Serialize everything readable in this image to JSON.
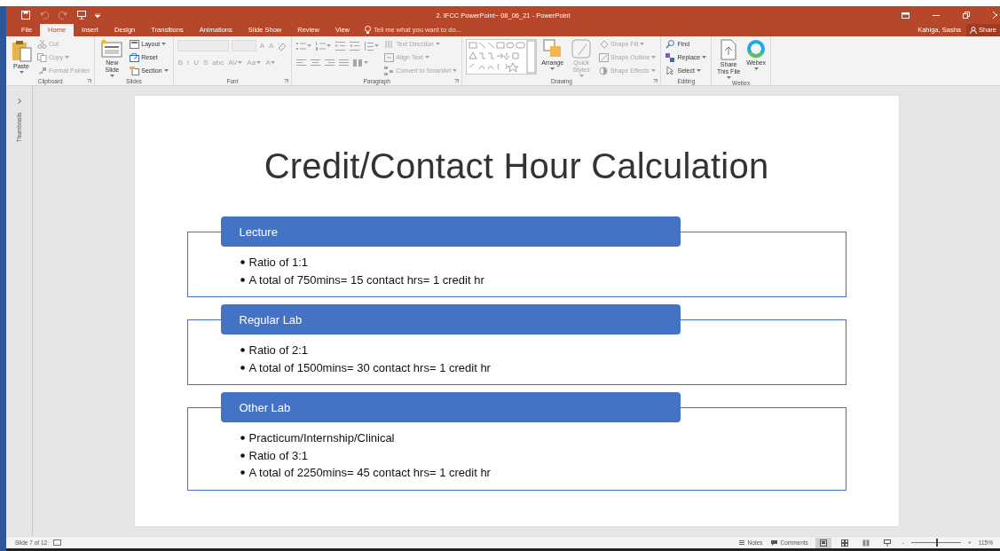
{
  "window": {
    "title": "2. IFCC PowerPoint~ 08_06_21 - PowerPoint",
    "user": "Kahiga, Sasha",
    "share": "Share"
  },
  "quick_access": [
    {
      "disabled": false
    },
    {
      "disabled": true
    },
    {
      "disabled": true
    },
    {
      "disabled": false
    }
  ],
  "tabs": [
    {
      "label": "File",
      "selected": false
    },
    {
      "label": "Home",
      "selected": true
    },
    {
      "label": "Insert",
      "selected": false
    },
    {
      "label": "Design",
      "selected": false
    },
    {
      "label": "Transitions",
      "selected": false
    },
    {
      "label": "Animations",
      "selected": false
    },
    {
      "label": "Slide Show",
      "selected": false
    },
    {
      "label": "Review",
      "selected": false
    },
    {
      "label": "View",
      "selected": false
    }
  ],
  "tell_me": {
    "placeholder": "Tell me what you want to do..."
  },
  "ribbon": [
    {
      "name": "Clipboard",
      "launcher": true,
      "columns": [
        [
          {
            "kind": "large",
            "label": "Paste",
            "dropdown": true,
            "disabled": false
          }
        ],
        [
          {
            "kind": "small",
            "label": "Cut",
            "dropdown": false,
            "disabled": true
          },
          {
            "kind": "small",
            "label": "Copy",
            "dropdown": true,
            "disabled": true
          },
          {
            "kind": "small",
            "label": "Format Painter",
            "dropdown": false,
            "disabled": true
          }
        ]
      ]
    },
    {
      "name": "Slides",
      "launcher": false,
      "columns": [
        [
          {
            "kind": "large",
            "label": "New Slide",
            "dropdown": true,
            "disabled": false
          }
        ],
        [
          {
            "kind": "small",
            "label": "Layout",
            "dropdown": true,
            "disabled": false
          },
          {
            "kind": "small",
            "label": "Reset",
            "dropdown": false,
            "disabled": false
          },
          {
            "kind": "small",
            "label": "Section",
            "dropdown": true,
            "disabled": false
          }
        ]
      ]
    },
    {
      "name": "Font",
      "launcher": true,
      "columns": [
        [
          {
            "kind": "row",
            "items": [
              {
                "kind": "field",
                "disabled": true
              },
              {
                "kind": "field",
                "disabled": true
              },
              {
                "kind": "glyph",
                "label": "A",
                "dropdown": false,
                "disabled": true
              },
              {
                "kind": "glyph",
                "label": "A",
                "dropdown": false,
                "disabled": true
              },
              {
                "kind": "icon",
                "dropdown": false,
                "disabled": true
              }
            ]
          },
          {
            "kind": "row",
            "items": [
              {
                "kind": "glyph",
                "label": "B",
                "dropdown": false,
                "disabled": true
              },
              {
                "kind": "glyph",
                "label": "I",
                "dropdown": false,
                "disabled": true
              },
              {
                "kind": "glyph",
                "label": "U",
                "dropdown": false,
                "disabled": true
              },
              {
                "kind": "glyph",
                "label": "S",
                "dropdown": false,
                "disabled": true
              },
              {
                "kind": "glyph",
                "label": "abc",
                "dropdown": false,
                "disabled": true
              },
              {
                "kind": "glyph",
                "label": "AV",
                "dropdown": true,
                "disabled": true
              },
              {
                "kind": "glyph",
                "label": "Aa",
                "dropdown": true,
                "disabled": true
              },
              {
                "kind": "glyph",
                "label": "A",
                "dropdown": true,
                "disabled": true
              }
            ]
          }
        ]
      ]
    },
    {
      "name": "Paragraph",
      "launcher": true,
      "columns": [
        [
          {
            "kind": "row",
            "items": [
              {
                "kind": "icon",
                "dropdown": true,
                "disabled": true
              },
              {
                "kind": "icon",
                "dropdown": true,
                "disabled": true
              },
              {
                "kind": "icon",
                "dropdown": false,
                "disabled": true
              },
              {
                "kind": "icon",
                "dropdown": false,
                "disabled": true
              },
              {
                "kind": "icon",
                "dropdown": true,
                "disabled": true
              }
            ]
          },
          {
            "kind": "row",
            "items": [
              {
                "kind": "icon",
                "dropdown": false,
                "disabled": true
              },
              {
                "kind": "icon",
                "dropdown": false,
                "disabled": true
              },
              {
                "kind": "icon",
                "dropdown": false,
                "disabled": true
              },
              {
                "kind": "icon",
                "dropdown": false,
                "disabled": true
              },
              {
                "kind": "icon",
                "dropdown": true,
                "disabled": true
              }
            ]
          }
        ],
        [
          {
            "kind": "small",
            "label": "Text Direction",
            "dropdown": true,
            "disabled": true
          },
          {
            "kind": "small",
            "label": "Align Text",
            "dropdown": true,
            "disabled": true
          },
          {
            "kind": "small",
            "label": "Convert to SmartArt",
            "dropdown": true,
            "disabled": true
          }
        ]
      ]
    },
    {
      "name": "Drawing",
      "launcher": true,
      "columns": [
        [
          {
            "kind": "gallery",
            "disabled": true
          }
        ],
        [
          {
            "kind": "large",
            "label": "Arrange",
            "dropdown": true,
            "disabled": false
          }
        ],
        [
          {
            "kind": "large",
            "label": "Quick Styles",
            "dropdown": true,
            "disabled": true
          }
        ],
        [
          {
            "kind": "small",
            "label": "Shape Fill",
            "dropdown": true,
            "disabled": true
          },
          {
            "kind": "small",
            "label": "Shape Outline",
            "dropdown": true,
            "disabled": true
          },
          {
            "kind": "small",
            "label": "Shape Effects",
            "dropdown": true,
            "disabled": true
          }
        ]
      ]
    },
    {
      "name": "Editing",
      "launcher": false,
      "columns": [
        [
          {
            "kind": "small",
            "label": "Find",
            "dropdown": false,
            "disabled": false
          },
          {
            "kind": "small",
            "label": "Replace",
            "dropdown": true,
            "disabled": false
          },
          {
            "kind": "small",
            "label": "Select",
            "dropdown": true,
            "disabled": false
          }
        ]
      ]
    },
    {
      "name": "Webex",
      "launcher": false,
      "columns": [
        [
          {
            "kind": "large",
            "label": "Share This File",
            "dropdown": true,
            "disabled": false
          }
        ],
        [
          {
            "kind": "large",
            "label": "Webex",
            "dropdown": true,
            "disabled": false
          }
        ]
      ]
    }
  ],
  "thumbnails_pane": {
    "label": "Thumbnails"
  },
  "slide": {
    "title": "Credit/Contact Hour Calculation",
    "sections": [
      {
        "heading": "Lecture",
        "bullets": [
          "Ratio of 1:1",
          "A total of 750mins= 15 contact hrs= 1 credit hr"
        ]
      },
      {
        "heading": "Regular Lab",
        "bullets": [
          "Ratio of 2:1",
          "A total of 1500mins= 30 contact hrs= 1 credit hr"
        ]
      },
      {
        "heading": "Other Lab",
        "bullets": [
          "Practicum/Internship/Clinical",
          "Ratio of 3:1",
          "A total of 2250mins= 45 contact hrs= 1 credit hr"
        ]
      }
    ]
  },
  "status_bar": {
    "slide_info": "Slide 7 of 12",
    "notes": "Notes",
    "comments": "Comments",
    "views": [
      {
        "selected": true
      },
      {
        "selected": false
      },
      {
        "selected": false
      },
      {
        "selected": false
      }
    ],
    "zoom_out": "-",
    "zoom_in": "+",
    "zoom": {
      "level": 0.52
    },
    "zoom_reading": "115%"
  }
}
